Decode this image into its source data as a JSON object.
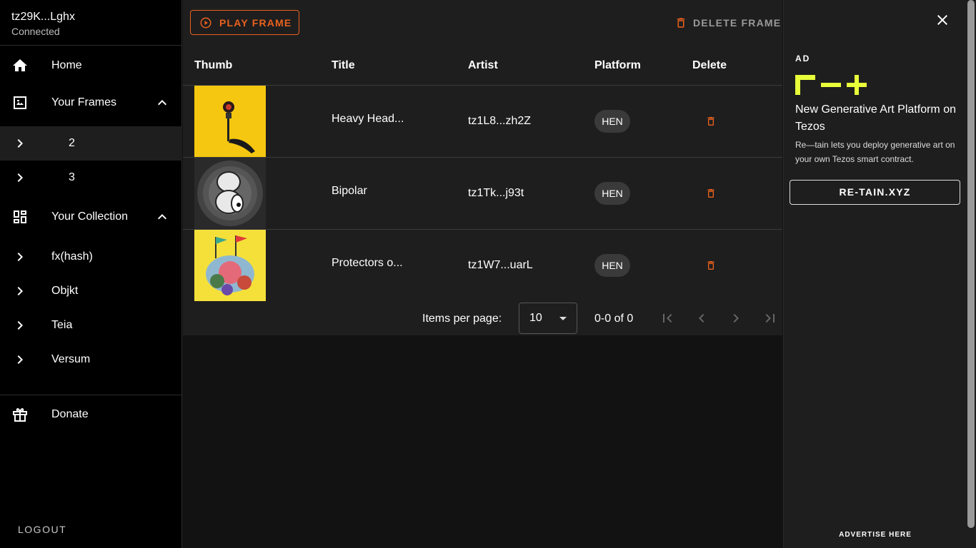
{
  "account": {
    "address": "tz29K...Lghx",
    "status": "Connected"
  },
  "nav": {
    "home": "Home",
    "your_frames": "Your Frames",
    "frames": [
      "2",
      "3"
    ],
    "your_collection": "Your Collection",
    "collection": [
      "fx(hash)",
      "Objkt",
      "Teia",
      "Versum"
    ],
    "donate": "Donate",
    "logout": "LOGOUT"
  },
  "toolbar": {
    "play_label": "PLAY FRAME",
    "delete_label": "DELETE FRAME"
  },
  "table": {
    "headers": [
      "Thumb",
      "Title",
      "Artist",
      "Platform",
      "Delete"
    ],
    "rows": [
      {
        "title": "Heavy Head...",
        "artist": "tz1L8...zh2Z",
        "platform": "HEN"
      },
      {
        "title": "Bipolar",
        "artist": "tz1Tk...j93t",
        "platform": "HEN"
      },
      {
        "title": "Protectors o...",
        "artist": "tz1W7...uarL",
        "platform": "HEN"
      }
    ]
  },
  "pagination": {
    "items_per_page_label": "Items per page:",
    "items_per_page": "10",
    "range": "0-0 of 0"
  },
  "ad": {
    "label": "AD",
    "headline": "New Generative Art Platform on Tezos",
    "description": "Re—tain lets you deploy generative art on your own Tezos smart contract.",
    "cta": "RE-TAIN.XYZ",
    "advertise": "ADVERTISE HERE"
  },
  "colors": {
    "accent": "#e9611e",
    "logo": "#e8ff3a",
    "sidebar_bg": "#000000",
    "panel_bg": "#1e1e1e"
  }
}
